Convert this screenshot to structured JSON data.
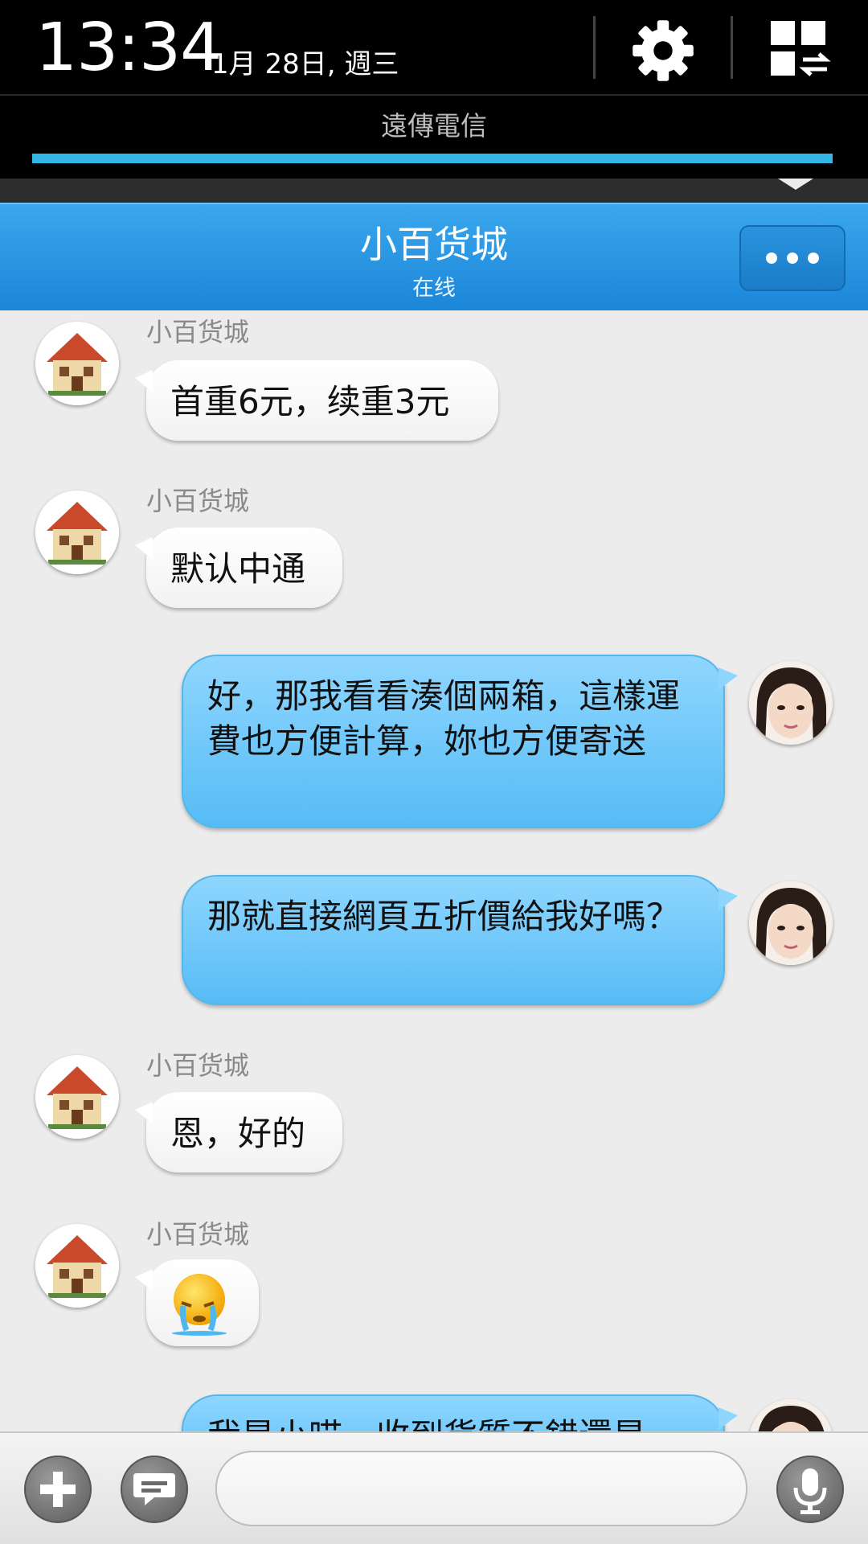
{
  "status": {
    "time": "13:34",
    "date": "1月 28日, 週三",
    "carrier": "遠傳電信",
    "brightness_level": 1.0
  },
  "header": {
    "title": "小百货城",
    "subtitle": "在线"
  },
  "messages": [
    {
      "direction": "in",
      "sender": "小百货城",
      "text": "首重6元，续重3元"
    },
    {
      "direction": "in",
      "sender": "小百货城",
      "text": "默认中通"
    },
    {
      "direction": "out",
      "text": "好，那我看看湊個兩箱，這樣運費也方便計算，妳也方便寄送"
    },
    {
      "direction": "out",
      "text": "那就直接網頁五折價給我好嗎？"
    },
    {
      "direction": "in",
      "sender": "小百货城",
      "text": "恩，好的"
    },
    {
      "direction": "in",
      "sender": "小百货城",
      "text": "",
      "emoji": "crying-face-emoji"
    },
    {
      "direction": "out",
      "text": "我是小喵，收到貨質不錯還是"
    }
  ],
  "input": {
    "placeholder": ""
  },
  "colors": {
    "accent": "#33b5e5",
    "header": "#1b86d7",
    "outgoing_bubble": "#56bcf5"
  }
}
